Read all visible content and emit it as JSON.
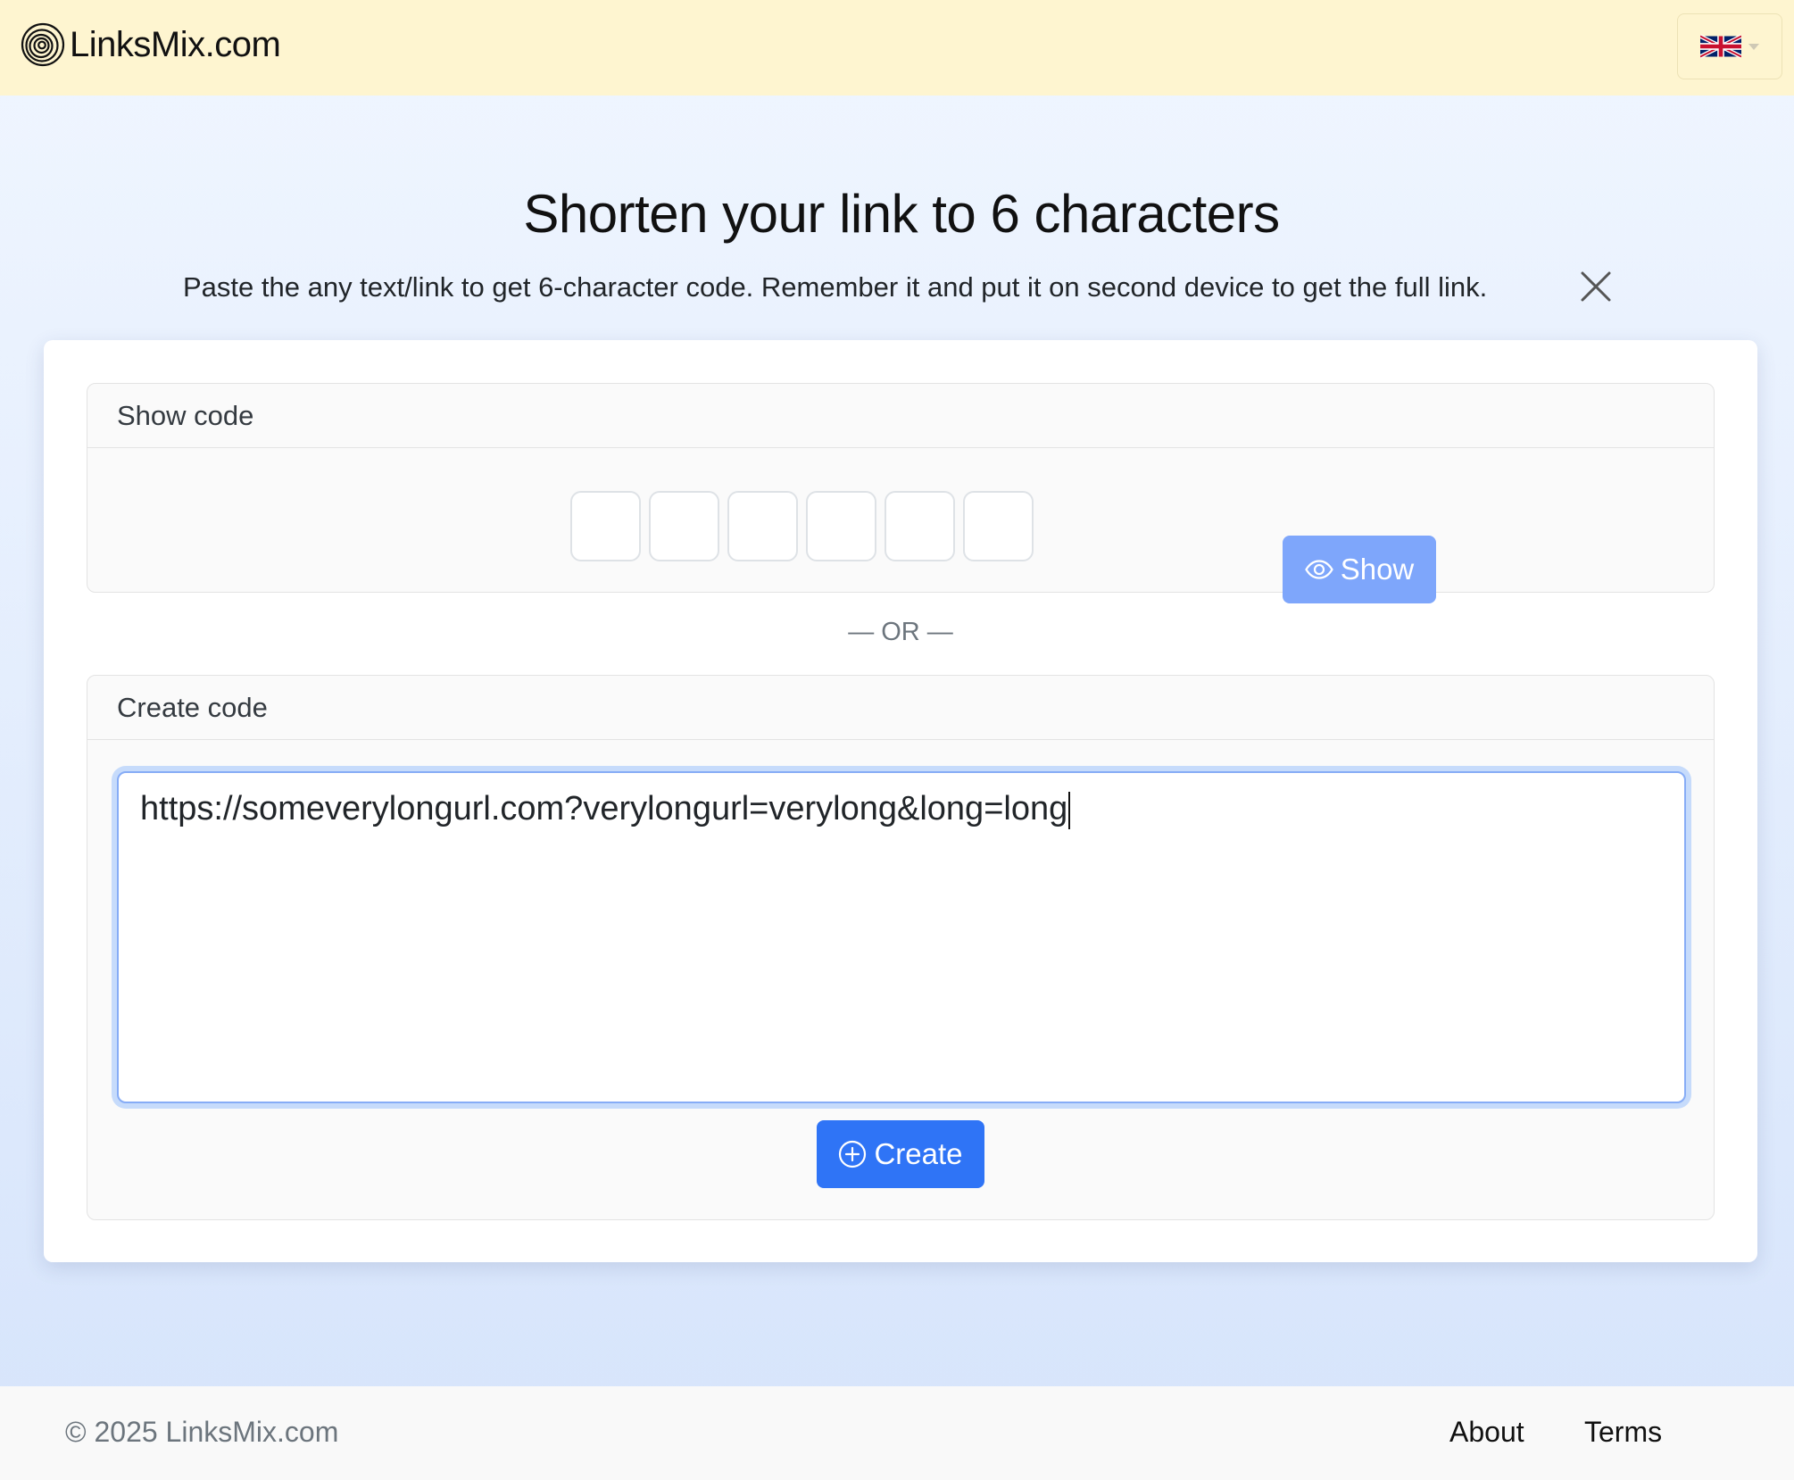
{
  "navbar": {
    "brand": "LinksMix.com",
    "brand_icon": "spiral-logo-icon",
    "language": {
      "selected": "English",
      "icon": "uk-flag-icon"
    },
    "background": "#fef5d0"
  },
  "hero": {
    "title": "Shorten your link to 6 characters",
    "subtitle": "Paste the any text/link to get 6-character code. Remember it and put it on second device to get the full link."
  },
  "show_panel": {
    "header": "Show code",
    "code_boxes": [
      "",
      "",
      "",
      "",
      "",
      ""
    ],
    "button_label": "Show",
    "button_icon": "eye-icon",
    "button_color": "#7ea6fb"
  },
  "divider": "— OR —",
  "create_panel": {
    "header": "Create code",
    "textarea_value": "https://someverylongurl.com?verylongurl=verylong&long=long",
    "button_label": "Create",
    "button_icon": "plus-circle-icon",
    "button_color": "#2f74f6"
  },
  "footer": {
    "copyright": "© 2025 LinksMix.com",
    "links": [
      "About",
      "Terms"
    ]
  }
}
